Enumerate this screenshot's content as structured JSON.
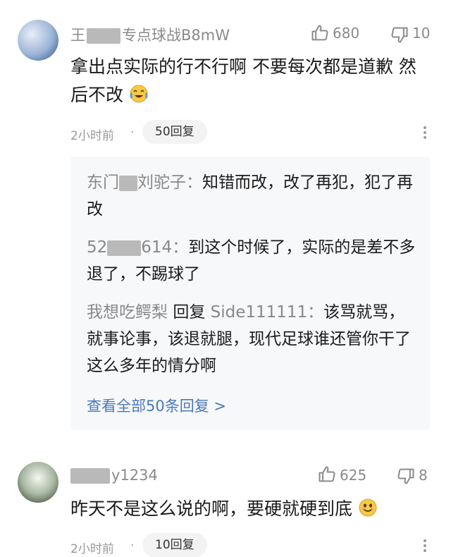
{
  "comments": [
    {
      "author_prefix": "王",
      "author_suffix": "专点球战B8mW",
      "likes": "680",
      "dislikes": "10",
      "text": "拿出点实际的行不行啊 不要每次都是道歉 然后不改",
      "emoji_icon": "crying-laughing-face-icon",
      "time": "2小时前",
      "dot": "·",
      "reply_count": "50回复",
      "replies": [
        {
          "name_prefix": "东门",
          "name_suffix": "刘驼子",
          "sep": "：",
          "text": "知错而改，改了再犯，犯了再改"
        },
        {
          "name_prefix": "52",
          "name_suffix": "614",
          "sep": "：",
          "text": "到这个时候了，实际的是差不多退了，不踢球了"
        },
        {
          "name": "我想吃鳄梨",
          "verb": "回复",
          "target": "Side111111",
          "sep": "：",
          "text": "该骂就骂，就事论事，该退就腿，现代足球谁还管你干了这么多年的情分啊"
        }
      ],
      "view_all": "查看全部50条回复 >"
    },
    {
      "author_suffix": "y1234",
      "likes": "625",
      "dislikes": "8",
      "text": "昨天不是这么说的啊，要硬就硬到底",
      "emoji_icon": "smiling-face-icon",
      "time": "2小时前",
      "dot": "·",
      "reply_count": "10回复"
    }
  ],
  "colors": {
    "link": "#4a78b8",
    "reply_bg": "#f7f8fa",
    "muted": "#8a8a8a"
  }
}
